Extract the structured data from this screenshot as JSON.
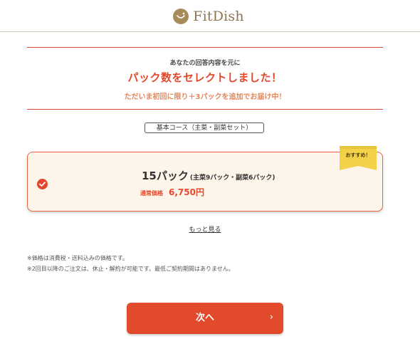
{
  "header": {
    "brand": "FitDish",
    "brand_icon": "smile-mark-icon"
  },
  "intro": {
    "sub_caption": "あなたの回答内容を元に",
    "headline": "パック数をセレクトしました！",
    "promo": "ただいま初回に限り＋3パックを追加でお届け中！"
  },
  "course_badge": "基本コース（主菜・副菜セット）",
  "option": {
    "selected": true,
    "recommend_label": "おすすめ！",
    "pack_count": "15パック",
    "pack_detail": "(主菜9パック・副菜6パック)",
    "price_label": "通常価格",
    "price": "6,750円"
  },
  "more_link": "もっと見る",
  "notes": [
    "※価格は消費税・送料込みの価格です。",
    "※2回目以降のご注文は、休止・解約が可能です。最低ご契約期間はありません。"
  ],
  "next_button": {
    "label": "次へ",
    "icon": "chevron-right-icon"
  },
  "colors": {
    "accent": "#e2482b",
    "brand": "#8c7550",
    "card_bg": "#fdf4ea",
    "ribbon": "#f3d24a"
  }
}
